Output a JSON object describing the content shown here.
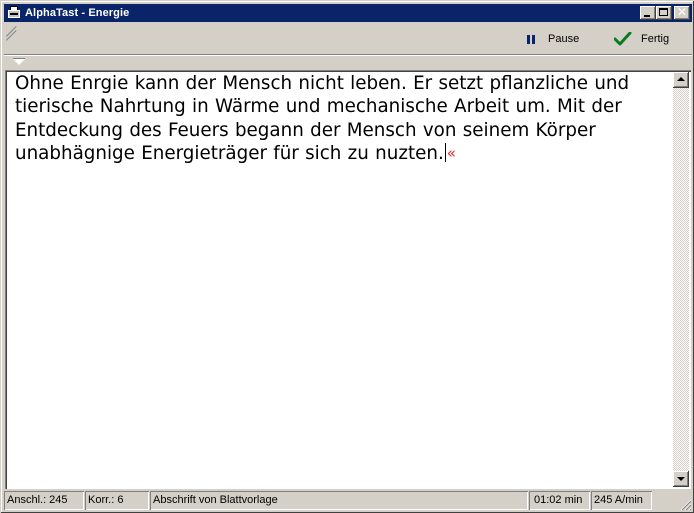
{
  "window": {
    "title": "AlphaTast - Energie",
    "app_icon": "typewriter-icon",
    "minimize_icon": "minimize-icon",
    "maximize_icon": "maximize-icon",
    "close_glyph": "✕"
  },
  "toolbar": {
    "pause_label": "Pause",
    "pause_icon": "pause-icon",
    "done_label": "Fertig",
    "done_icon": "checkmark-icon",
    "accent_color": "#0a246a",
    "check_color": "#0a7a1f"
  },
  "editor": {
    "text": "Ohne Enrgie kann der Mensch nicht leben. Er setzt pflanzliche und tierische Nahrtung in Wärme und mechanische Arbeit um. Mit der Entdeckung des Feuers begann der Mensch von seinem Körper unabhägnige Energieträger für sich zu nuzten.",
    "end_marker": "«",
    "end_marker_color": "#e0252b"
  },
  "statusbar": {
    "strokes": "Anschl.: 245",
    "corrections": "Korr.: 6",
    "mode": "Abschrift von Blattvorlage",
    "time": "01:02 min",
    "speed": "245 A/min"
  }
}
